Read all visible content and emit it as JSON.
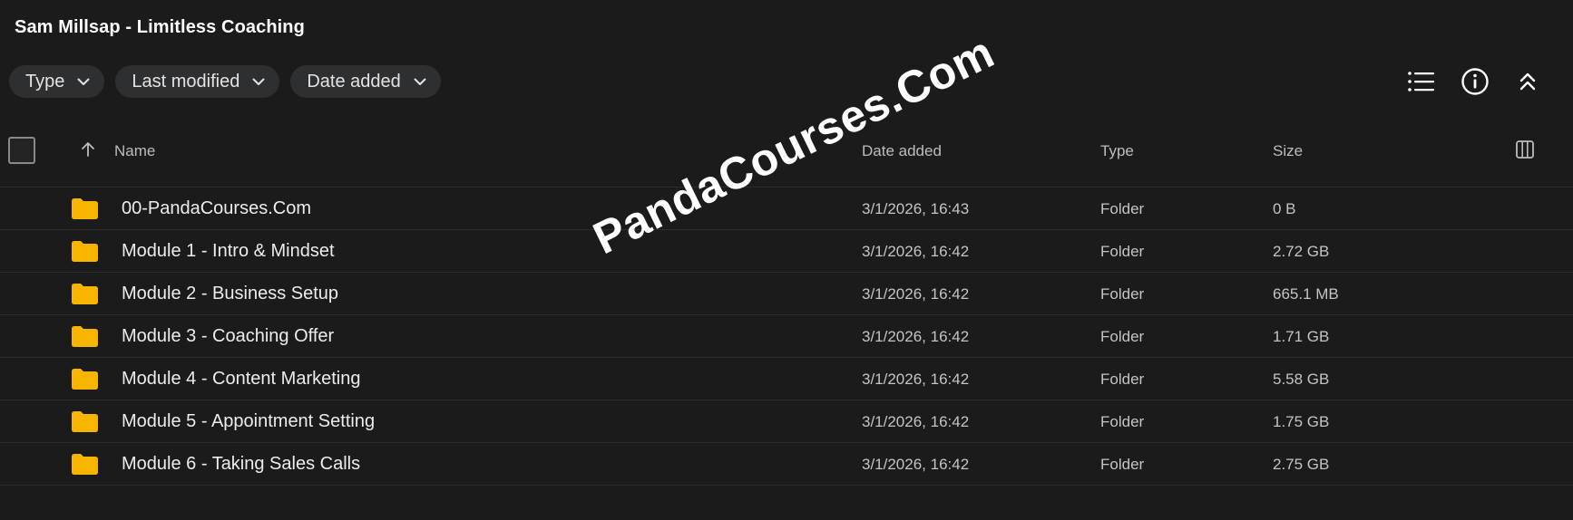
{
  "title": "Sam Millsap - Limitless Coaching",
  "filters": [
    {
      "label": "Type"
    },
    {
      "label": "Last modified"
    },
    {
      "label": "Date added"
    }
  ],
  "toolbar": {
    "icons": [
      "list-view-icon",
      "info-icon",
      "collapse-icon"
    ]
  },
  "table": {
    "columns": {
      "name": "Name",
      "date": "Date added",
      "type": "Type",
      "size": "Size"
    },
    "sort": "ascending",
    "rows": [
      {
        "name": "00-PandaCourses.Com",
        "date": "3/1/2026, 16:43",
        "type": "Folder",
        "size": "0 B"
      },
      {
        "name": "Module 1 - Intro & Mindset",
        "date": "3/1/2026, 16:42",
        "type": "Folder",
        "size": "2.72 GB"
      },
      {
        "name": "Module 2 - Business Setup",
        "date": "3/1/2026, 16:42",
        "type": "Folder",
        "size": "665.1 MB"
      },
      {
        "name": "Module 3 - Coaching Offer",
        "date": "3/1/2026, 16:42",
        "type": "Folder",
        "size": "1.71 GB"
      },
      {
        "name": "Module 4 - Content Marketing",
        "date": "3/1/2026, 16:42",
        "type": "Folder",
        "size": "5.58 GB"
      },
      {
        "name": "Module 5 - Appointment Setting",
        "date": "3/1/2026, 16:42",
        "type": "Folder",
        "size": "1.75 GB"
      },
      {
        "name": "Module 6 - Taking Sales Calls",
        "date": "3/1/2026, 16:42",
        "type": "Folder",
        "size": "2.75 GB"
      }
    ]
  },
  "watermark": "PandaCourses.Com",
  "colors": {
    "background": "#1b1b1b",
    "chip": "#2e2f31",
    "folder": "#f7b500",
    "divider": "#2c2c2c"
  }
}
